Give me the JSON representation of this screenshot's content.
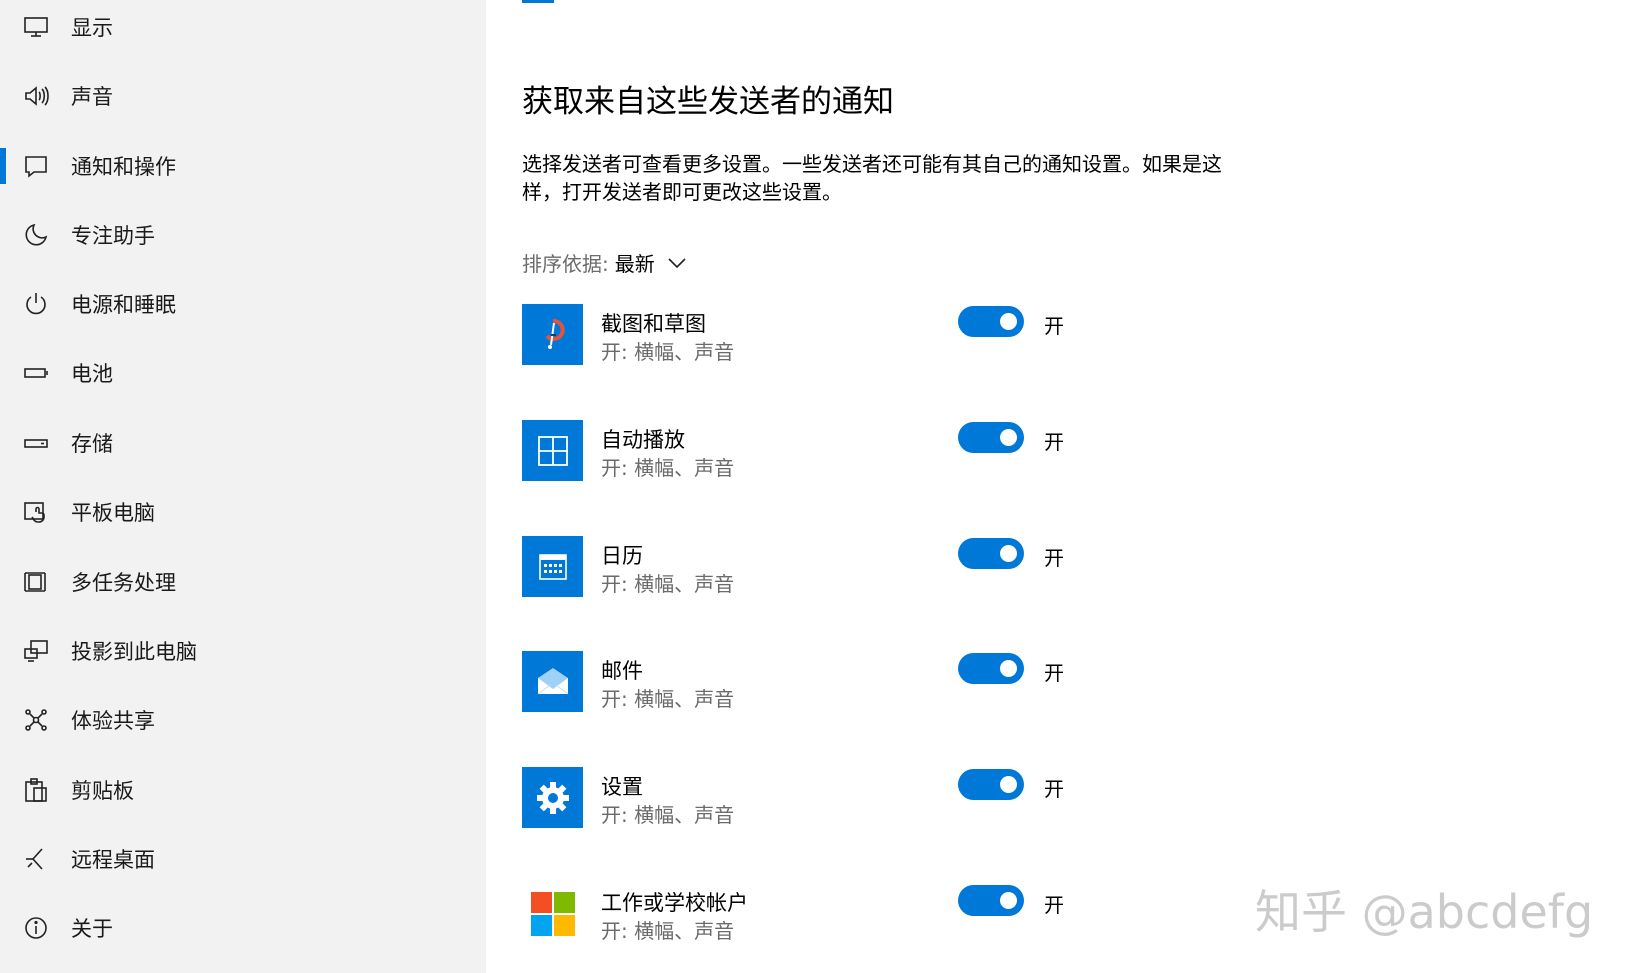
{
  "sidebar": {
    "items": [
      {
        "label": "显示",
        "icon": "monitor-icon"
      },
      {
        "label": "声音",
        "icon": "speaker-icon"
      },
      {
        "label": "通知和操作",
        "icon": "message-icon",
        "selected": true
      },
      {
        "label": "专注助手",
        "icon": "moon-icon"
      },
      {
        "label": "电源和睡眠",
        "icon": "power-icon"
      },
      {
        "label": "电池",
        "icon": "battery-icon"
      },
      {
        "label": "存储",
        "icon": "drive-icon"
      },
      {
        "label": "平板电脑",
        "icon": "tablet-icon"
      },
      {
        "label": "多任务处理",
        "icon": "multitask-icon"
      },
      {
        "label": "投影到此电脑",
        "icon": "project-icon"
      },
      {
        "label": "体验共享",
        "icon": "share-icon"
      },
      {
        "label": "剪贴板",
        "icon": "clipboard-icon"
      },
      {
        "label": "远程桌面",
        "icon": "remote-desktop-icon"
      },
      {
        "label": "关于",
        "icon": "info-icon"
      }
    ]
  },
  "main": {
    "title": "获取来自这些发送者的通知",
    "description": "选择发送者可查看更多设置。一些发送者还可能有其自己的通知设置。如果是这样，打开发送者即可更改这些设置。",
    "sort": {
      "label": "排序依据:",
      "value": "最新"
    },
    "senders": [
      {
        "name": "截图和草图",
        "sub": "开: 横幅、声音",
        "state": "开",
        "icon": "snip-sketch-icon",
        "on": true
      },
      {
        "name": "自动播放",
        "sub": "开: 横幅、声音",
        "state": "开",
        "icon": "autoplay-icon",
        "on": true
      },
      {
        "name": "日历",
        "sub": "开: 横幅、声音",
        "state": "开",
        "icon": "calendar-icon",
        "on": true
      },
      {
        "name": "邮件",
        "sub": "开: 横幅、声音",
        "state": "开",
        "icon": "mail-icon",
        "on": true
      },
      {
        "name": "设置",
        "sub": "开: 横幅、声音",
        "state": "开",
        "icon": "settings-gear-icon",
        "on": true
      },
      {
        "name": "工作或学校帐户",
        "sub": "开: 横幅、声音",
        "state": "开",
        "icon": "windows-logo-icon",
        "on": true
      }
    ]
  },
  "watermark": "知乎 @abcdefg",
  "colors": {
    "accent": "#0078d7",
    "sidebar_bg": "#f2f2f2",
    "secondary_text": "#6b6b6b"
  }
}
